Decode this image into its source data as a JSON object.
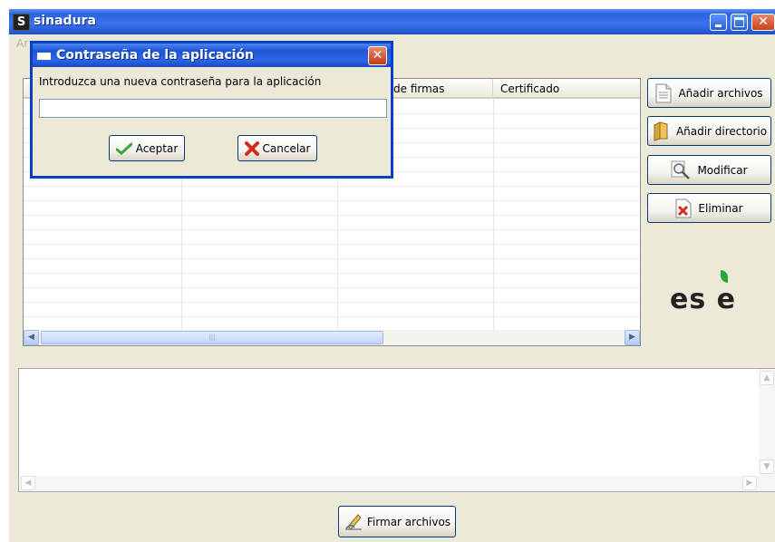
{
  "window": {
    "title": "sinadura"
  },
  "menubar": {
    "first_item": "Ar"
  },
  "table": {
    "columns": [
      "",
      "",
      "de firmas",
      "Certificado"
    ]
  },
  "side_buttons": [
    {
      "label": "Añadir archivos",
      "icon": "document-icon"
    },
    {
      "label": "Añadir directorio",
      "icon": "folder-icon"
    },
    {
      "label": "Modificar",
      "icon": "magnifier-icon"
    },
    {
      "label": "Eliminar",
      "icon": "delete-icon"
    }
  ],
  "logo": {
    "text": "es e",
    "leaf_color": "#2aa63a"
  },
  "bottom": {
    "sign_label": "Firmar archivos"
  },
  "dialog": {
    "title": "Contraseña de la aplicación",
    "label": "Introduzca una nueva contraseña para la aplicación",
    "input_value": "",
    "accept_label": "Aceptar",
    "cancel_label": "Cancelar"
  },
  "colors": {
    "titlebar": "#2a63e0",
    "window_bg": "#ece9d8",
    "accept_check": "#3aa63a",
    "cancel_x": "#d62b1f"
  }
}
